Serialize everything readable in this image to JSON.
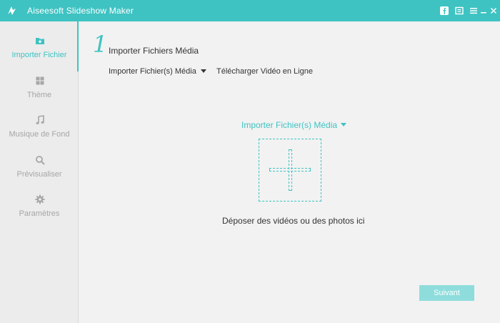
{
  "window": {
    "title": "Aiseesoft Slideshow Maker",
    "accent": "#3ec3c2",
    "controls": [
      "facebook-icon",
      "feedback-icon",
      "menu-icon",
      "minimize-icon",
      "close-icon"
    ]
  },
  "sidebar": {
    "items": [
      {
        "label": "Importer Fichier",
        "icon": "add-folder-icon",
        "active": true
      },
      {
        "label": "Thème",
        "icon": "grid-icon",
        "active": false
      },
      {
        "label": "Musique de Fond",
        "icon": "music-note-icon",
        "active": false
      },
      {
        "label": "Prévisualiser",
        "icon": "search-icon",
        "active": false
      },
      {
        "label": "Paramètres",
        "icon": "gear-icon",
        "active": false
      }
    ]
  },
  "main": {
    "step_number": "1",
    "step_title": "Importer Fichiers Média",
    "tabs": {
      "import": "Importer Fichier(s) Média",
      "download": "Télécharger Vidéo en Ligne"
    },
    "import_link": "Importer Fichier(s) Média",
    "drop_hint": "Déposer des vidéos ou des photos ici",
    "next_button": "Suivant"
  }
}
